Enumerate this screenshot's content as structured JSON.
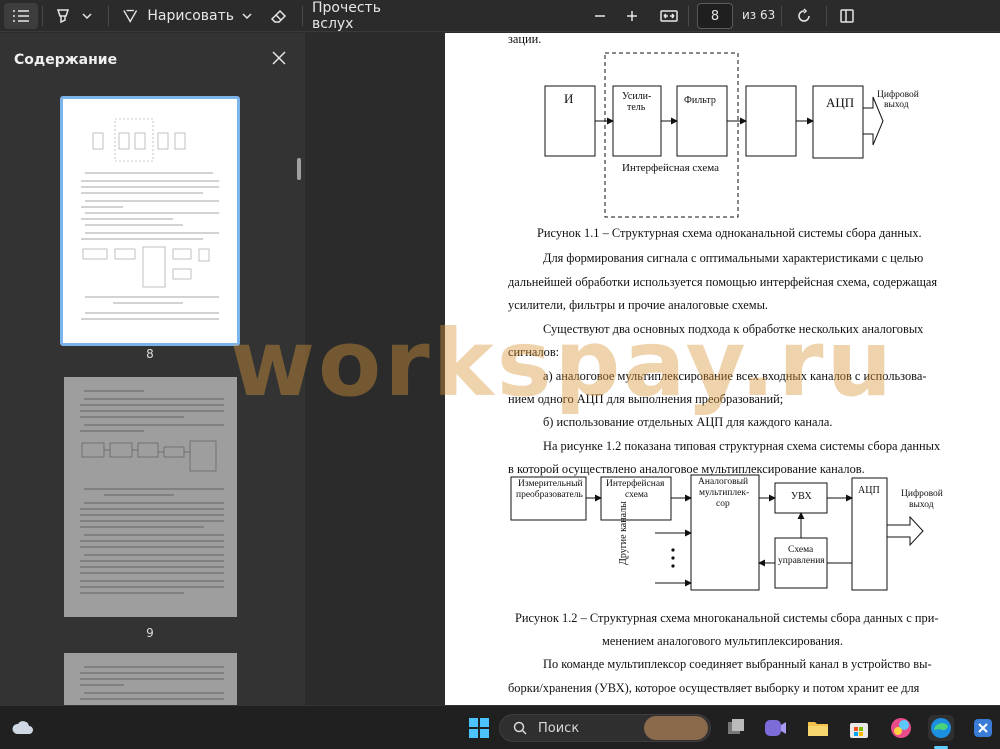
{
  "toolbar": {
    "draw_label": "Нарисовать",
    "read_aloud_label": "Прочесть вслух",
    "page_number": "8",
    "page_total": "из 63"
  },
  "sidebar": {
    "title": "Содержание",
    "thumbs": [
      {
        "label": "8"
      },
      {
        "label": "9"
      }
    ]
  },
  "document": {
    "top_fragment": "зации.",
    "fig1": {
      "block_i": "И",
      "block_amp_1": "Усили-",
      "block_amp_2": "тель",
      "block_filter": "Фильтр",
      "block_adc": "АЦП",
      "out_1": "Цифровой",
      "out_2": "выход",
      "dashed_label": "Интерфейсная схема"
    },
    "caption1": "Рисунок 1.1 – Структурная схема одноканальной системы сбора данных.",
    "para1_l1": "Для формирования сигнала с оптимальными характеристиками с целью",
    "para1_l2": "дальнейшей обработки используется помощью интерфейсная схема, содержащая",
    "para1_l3": "усилители, фильтры и прочие аналоговые схемы.",
    "para2_l1": "Существуют два основных подхода к обработке нескольких аналоговых",
    "para2_l2": "сигналов:",
    "item_a_l1": "а) аналоговое мультиплексирование всех входных каналов с использова-",
    "item_a_l2": "нием одного АЦП для выполнения преобразований;",
    "item_b": "б) использование отдельных АЦП для каждого канала.",
    "para3_l1": "На рисунке 1.2 показана типовая структурная схема системы сбора данных",
    "para3_l2": "в которой осуществлено аналоговое мультиплексирование каналов.",
    "fig2": {
      "meas_1": "Измерительный",
      "meas_2": "преобразователь",
      "iface_1": "Интерфейсная",
      "iface_2": "схема",
      "mux_1": "Аналоговый",
      "mux_2": "мультиплек-",
      "mux_3": "сор",
      "uvx": "УВХ",
      "adc": "АЦП",
      "ctrl_1": "Схема",
      "ctrl_2": "управления",
      "out_1": "Цифровой",
      "out_2": "выход",
      "other": "Другие каналы"
    },
    "caption2_l1": "Рисунок 1.2 – Структурная схема многоканальной системы сбора данных с при-",
    "caption2_l2": "менением аналогового мультиплексирования.",
    "para4_l1": "По команде мультиплексор соединяет выбранный канал в устройство вы-",
    "para4_l2": "борки/хранения (УВХ), которое осуществляет выборку и потом хранит ее для"
  },
  "watermark": "workspay.ru",
  "taskbar": {
    "search_label": "Поиск"
  }
}
